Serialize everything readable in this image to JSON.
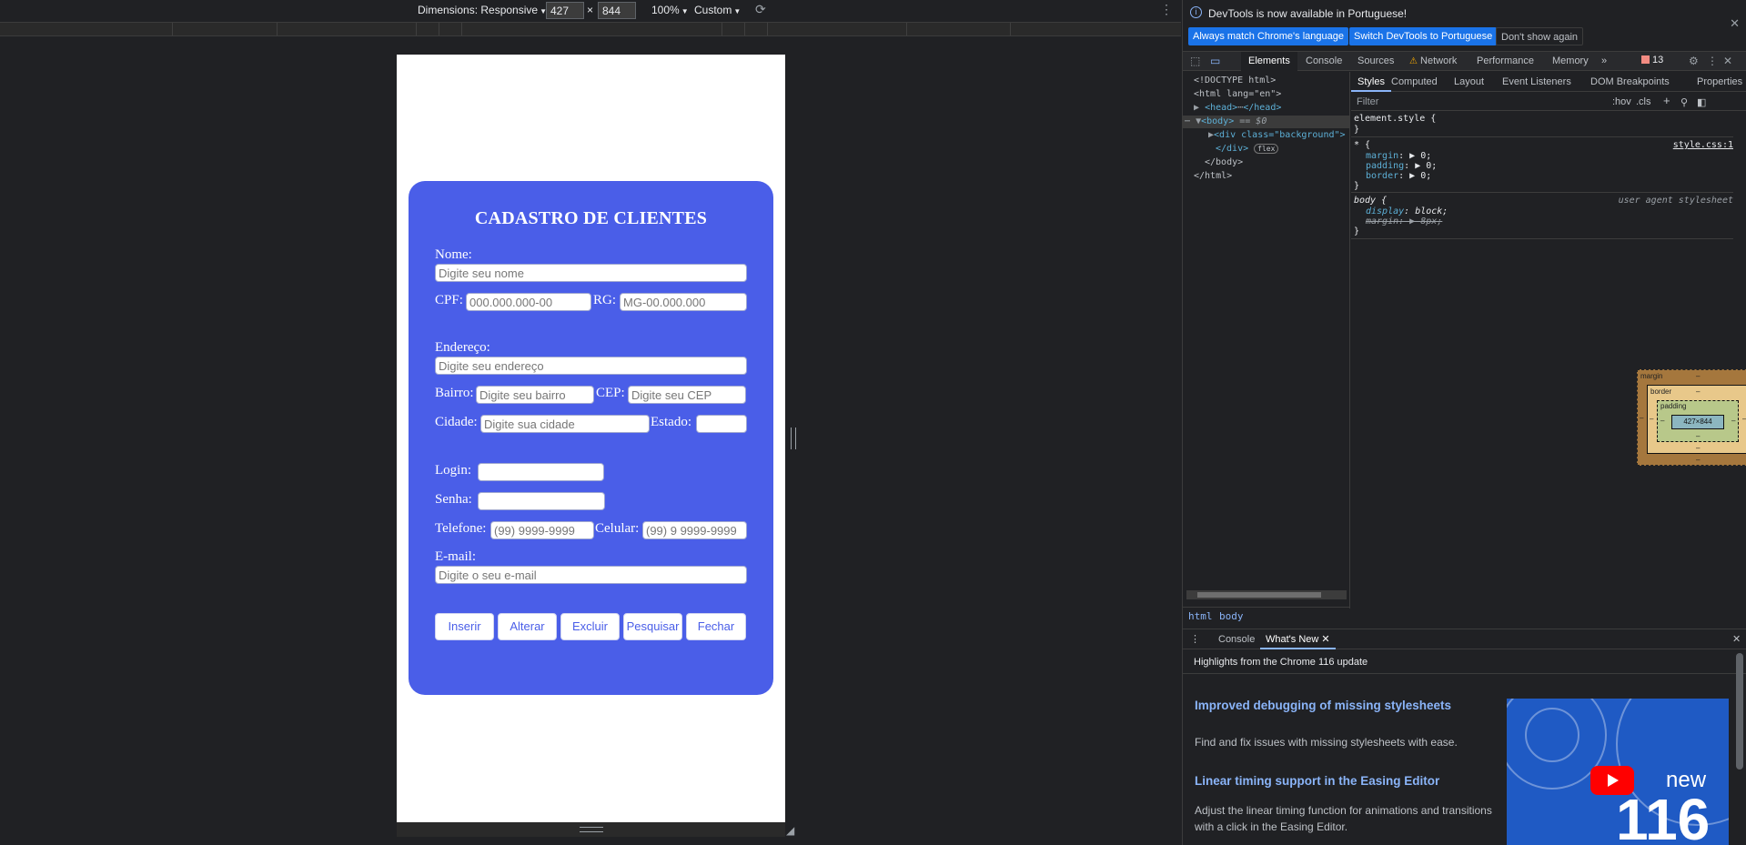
{
  "emulation_toolbar": {
    "dimensions_label": "Dimensions: Responsive",
    "width": "427",
    "times": "×",
    "height": "844",
    "zoom": "100%",
    "throttle": "Custom"
  },
  "form": {
    "title": "CADASTRO DE CLIENTES",
    "nome_label": "Nome:",
    "nome_placeholder": "Digite seu nome",
    "cpf_label": "CPF:",
    "cpf_placeholder": "000.000.000-00",
    "rg_label": "RG:",
    "rg_placeholder": "MG-00.000.000",
    "endereco_label": "Endereço:",
    "endereco_placeholder": "Digite seu endereço",
    "bairro_label": "Bairro:",
    "bairro_placeholder": "Digite seu bairro",
    "cep_label": "CEP:",
    "cep_placeholder": "Digite seu CEP",
    "cidade_label": "Cidade:",
    "cidade_placeholder": "Digite sua cidade",
    "estado_label": "Estado:",
    "login_label": "Login:",
    "senha_label": "Senha:",
    "telefone_label": "Telefone:",
    "telefone_placeholder": "(99) 9999-9999",
    "celular_label": "Celular:",
    "celular_placeholder": "(99) 9 9999-9999",
    "email_label": "E-mail:",
    "email_placeholder": "Digite o seu e-mail",
    "buttons": [
      "Inserir",
      "Alterar",
      "Excluir",
      "Pesquisar",
      "Fechar"
    ]
  },
  "devtools": {
    "infobar": {
      "message": "DevTools is now available in Portuguese!",
      "btn_match": "Always match Chrome's language",
      "btn_switch": "Switch DevTools to Portuguese",
      "btn_dismiss": "Don't show again"
    },
    "tabs": [
      "Elements",
      "Console",
      "Sources",
      "Network",
      "Performance",
      "Memory"
    ],
    "error_count": "13",
    "dom": {
      "doctype": "<!DOCTYPE html>",
      "html_open": "<html lang=\"en\">",
      "head": "<head>",
      "head_close": "</head>",
      "body_open": "<body>",
      "body_marker": "== $0",
      "div": "<div class=\"background\">",
      "div_close": "</div>",
      "flex_badge": "flex",
      "body_close": "</body>",
      "html_close": "</html>"
    },
    "breadcrumbs": [
      "html",
      "body"
    ],
    "styles_tabs": [
      "Styles",
      "Computed",
      "Layout",
      "Event Listeners",
      "DOM Breakpoints",
      "Properties"
    ],
    "filter_placeholder": "Filter",
    "hov": ":hov",
    ".cls": ".cls",
    "rules": {
      "element_style": "element.style {",
      "universal_selector": "* {",
      "universal_source": "style.css:1",
      "margin": "margin",
      "padding": "padding",
      "border": "border",
      "zero": "0;",
      "body_selector": "body {",
      "ua_source": "user agent stylesheet",
      "display": "display",
      "block": "block;",
      "margin_ua": "margin",
      "ua_margin_val": "8px;",
      "close": "}"
    },
    "boxmodel": {
      "margin": "margin",
      "border": "border",
      "padding": "padding",
      "content": "427×844",
      "dash": "–"
    },
    "drawer": {
      "tabs": [
        "Console",
        "What's New"
      ],
      "subtitle": "Highlights from the Chrome 116 update",
      "items": [
        {
          "title": "Improved debugging of missing stylesheets",
          "desc": "Find and fix issues with missing stylesheets with ease."
        },
        {
          "title": "Linear timing support in the Easing Editor",
          "desc": "Adjust the linear timing function for animations and transitions with a click in the Easing Editor."
        }
      ],
      "image_new": "new",
      "image_num": "116"
    }
  }
}
